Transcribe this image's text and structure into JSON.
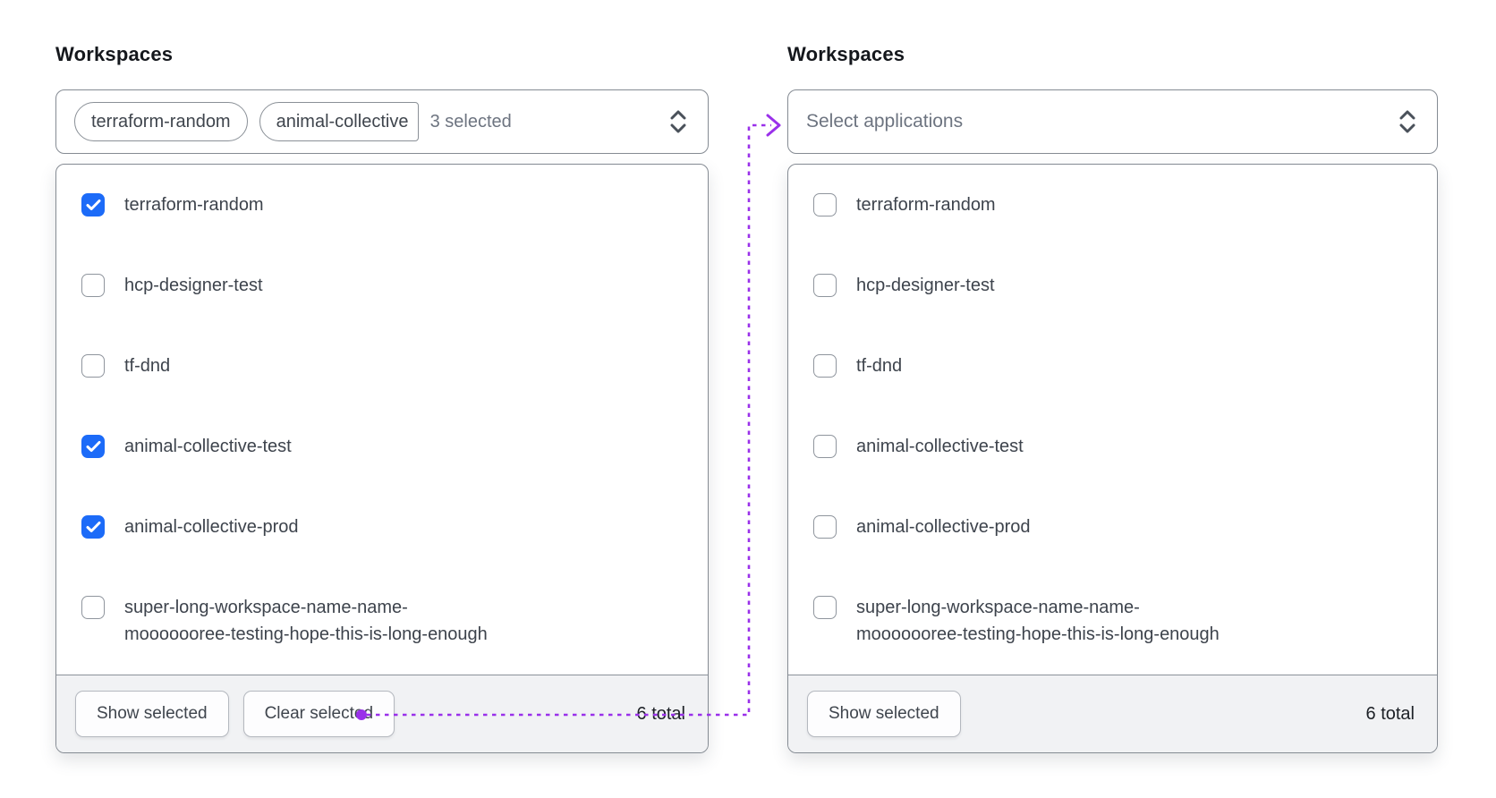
{
  "colors": {
    "checkbox_checked_blue": "#1c6bf8",
    "connector_purple": "#9a30ea",
    "panel_border_gray": "#858b93",
    "footer_background": "#f1f2f4",
    "option_text": "#3d434c",
    "muted_text": "#6d7480"
  },
  "left_panel": {
    "label": "Workspaces",
    "trigger": {
      "tags": [
        "terraform-random",
        "animal-collective"
      ],
      "selected_count_text": "3 selected",
      "caret_icon": "chevron-up-down-icon"
    },
    "options": [
      {
        "label": "terraform-random",
        "checked": true
      },
      {
        "label": "hcp-designer-test",
        "checked": false
      },
      {
        "label": "tf-dnd",
        "checked": false
      },
      {
        "label": "animal-collective-test",
        "checked": true
      },
      {
        "label": "animal-collective-prod",
        "checked": true
      },
      {
        "label": "super-long-workspace-name-name-\nmooooooree-testing-hope-this-is-long-enough",
        "checked": false
      }
    ],
    "footer": {
      "show_selected_label": "Show selected",
      "clear_selected_label": "Clear selected",
      "total_text": "6 total"
    }
  },
  "right_panel": {
    "label": "Workspaces",
    "trigger": {
      "placeholder": "Select applications",
      "caret_icon": "chevron-up-down-icon"
    },
    "options": [
      {
        "label": "terraform-random",
        "checked": false
      },
      {
        "label": "hcp-designer-test",
        "checked": false
      },
      {
        "label": "tf-dnd",
        "checked": false
      },
      {
        "label": "animal-collective-test",
        "checked": false
      },
      {
        "label": "animal-collective-prod",
        "checked": false
      },
      {
        "label": "super-long-workspace-name-name-\nmooooooree-testing-hope-this-is-long-enough",
        "checked": false
      }
    ],
    "footer": {
      "show_selected_label": "Show selected",
      "total_text": "6 total"
    }
  }
}
